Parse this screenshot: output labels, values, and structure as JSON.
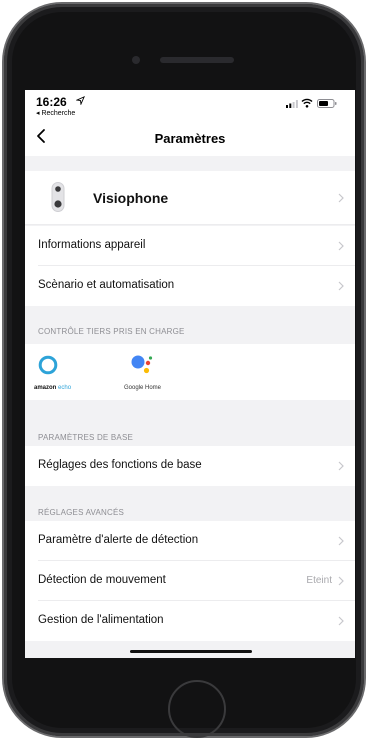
{
  "status_bar": {
    "time": "16:26",
    "back_app": "◂ Recherche"
  },
  "nav": {
    "title": "Paramètres"
  },
  "device": {
    "name": "Visiophone"
  },
  "rows_top": [
    {
      "label": "Informations appareil"
    },
    {
      "label": "Scènario et automatisation"
    }
  ],
  "sections": {
    "third_party": "CONTRÔLE TIERS PRIS EN CHARGE",
    "basic": "PARAMÈTRES DE BASE",
    "advanced": "RÉGLAGES AVANCÉS"
  },
  "integrations": {
    "echo_brand": "amazon",
    "echo_product": "echo",
    "google": "Google Home"
  },
  "basic_rows": [
    {
      "label": "Réglages des fonctions de base"
    }
  ],
  "advanced_rows": [
    {
      "label": "Paramètre d'alerte de détection",
      "value": ""
    },
    {
      "label": "Détection de mouvement",
      "value": "Eteint"
    },
    {
      "label": "Gestion de l'alimentation",
      "value": ""
    }
  ],
  "colors": {
    "background": "#f2f2f4",
    "chevron": "#c7c7cc",
    "echo_blue": "#2da3d8",
    "google_blue": "#4285f4",
    "google_red": "#ea4335",
    "google_yellow": "#fbbc05",
    "google_green": "#34a853"
  }
}
